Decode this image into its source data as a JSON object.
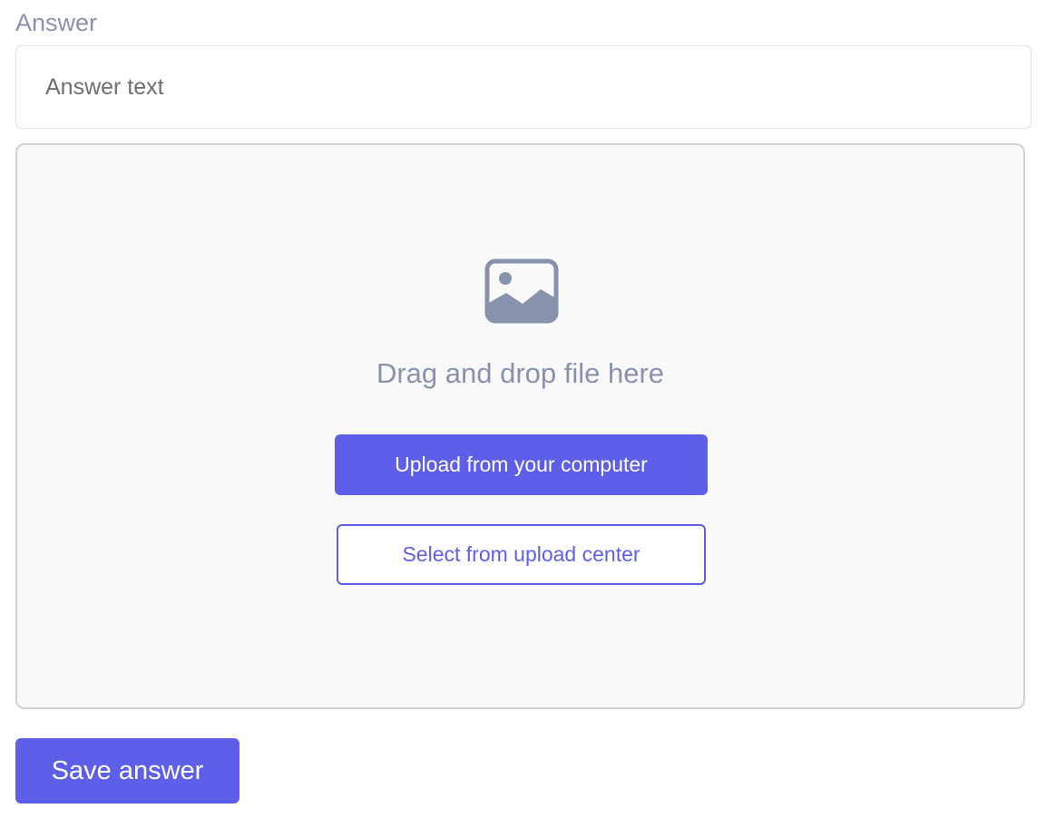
{
  "answer": {
    "label": "Answer",
    "input_value": "",
    "input_placeholder": "Answer text"
  },
  "upload": {
    "icon": "image-icon",
    "drop_text": "Drag and drop file here",
    "upload_button_label": "Upload from your computer",
    "select_button_label": "Select from upload center"
  },
  "actions": {
    "save_label": "Save answer"
  },
  "colors": {
    "accent": "#5d5fe8",
    "muted_text": "#8793ad",
    "dropzone_bg": "#f9f9f9",
    "dropzone_border": "#d2d2d2"
  }
}
